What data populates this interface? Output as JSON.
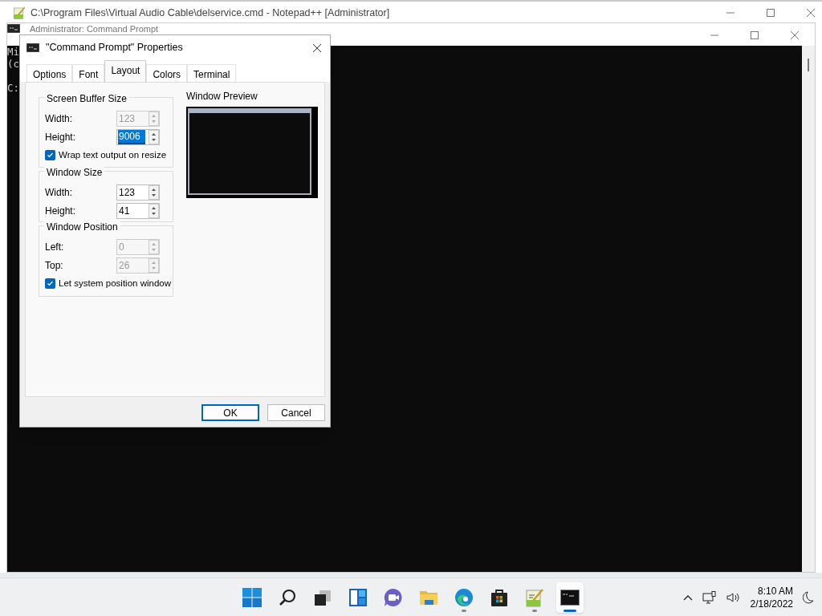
{
  "back_window": {
    "title": "C:\\Program Files\\Virtual Audio Cable\\delservice.cmd - Notepad++ [Administrator]"
  },
  "console_window": {
    "title": "Administrator: Command Prompt",
    "lines": [
      "Mi",
      "(c"
    ],
    "prompt": "C:"
  },
  "dialog": {
    "title": "\"Command Prompt\" Properties",
    "tabs": [
      {
        "label": "Options",
        "selected": false
      },
      {
        "label": "Font",
        "selected": false
      },
      {
        "label": "Layout",
        "selected": true
      },
      {
        "label": "Colors",
        "selected": false
      },
      {
        "label": "Terminal",
        "selected": false
      }
    ],
    "groups": [
      {
        "title": "Screen Buffer Size",
        "fields": [
          {
            "label": "Width:",
            "value": "123",
            "disabled": true,
            "selected": false
          },
          {
            "label": "Height:",
            "value": "9006",
            "disabled": false,
            "selected": true
          }
        ],
        "checkbox": {
          "label": "Wrap text output on resize",
          "checked": true
        }
      },
      {
        "title": "Window Size",
        "fields": [
          {
            "label": "Width:",
            "value": "123",
            "disabled": false,
            "selected": false
          },
          {
            "label": "Height:",
            "value": "41",
            "disabled": false,
            "selected": false
          }
        ]
      },
      {
        "title": "Window Position",
        "fields": [
          {
            "label": "Left:",
            "value": "0",
            "disabled": true,
            "selected": false
          },
          {
            "label": "Top:",
            "value": "26",
            "disabled": true,
            "selected": false
          }
        ],
        "checkbox": {
          "label": "Let system position window",
          "checked": true
        }
      }
    ],
    "preview": {
      "title": "Window Preview"
    },
    "buttons": [
      {
        "label": "OK",
        "default": true
      },
      {
        "label": "Cancel",
        "default": false
      }
    ]
  },
  "taskbar": {
    "apps": [
      {
        "kind": "start",
        "running": false,
        "selected": false
      },
      {
        "kind": "search",
        "running": false,
        "selected": false
      },
      {
        "kind": "taskview",
        "running": false,
        "selected": false
      },
      {
        "kind": "widgets",
        "running": false,
        "selected": false
      },
      {
        "kind": "chat",
        "running": false,
        "selected": false
      },
      {
        "kind": "explorer",
        "running": false,
        "selected": false
      },
      {
        "kind": "edge",
        "running": true,
        "selected": false
      },
      {
        "kind": "store",
        "running": false,
        "selected": false
      },
      {
        "kind": "notepad",
        "running": true,
        "selected": false
      },
      {
        "kind": "terminal",
        "running": true,
        "selected": true
      }
    ],
    "time": "8:10 AM",
    "date": "2/18/2022"
  }
}
